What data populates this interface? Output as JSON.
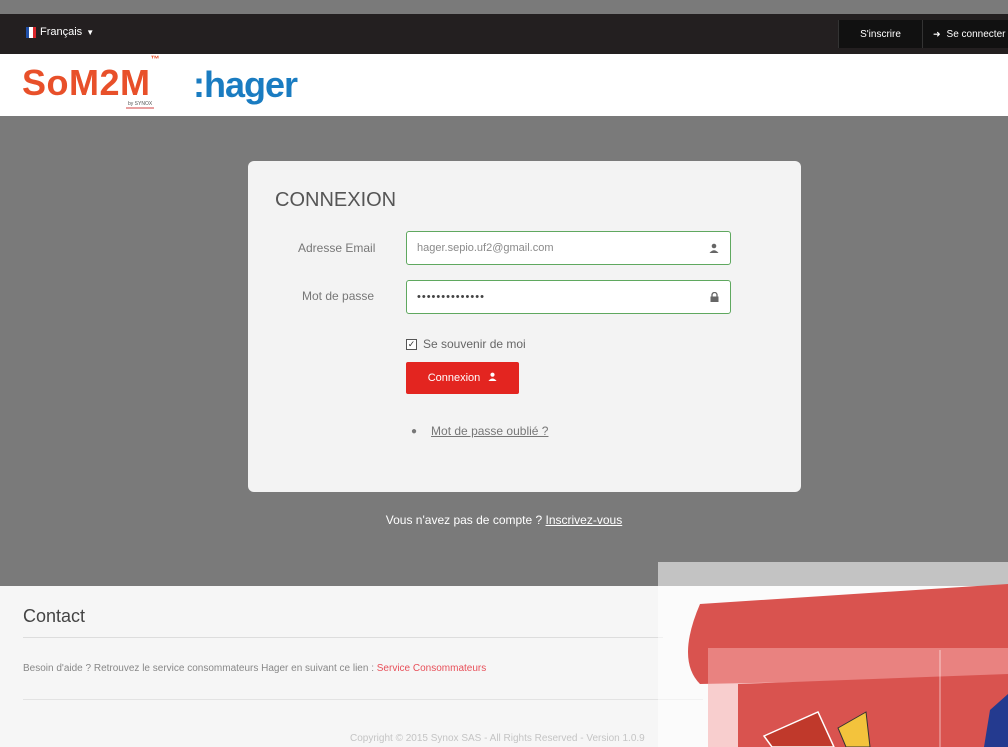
{
  "topbar": {
    "language": "Français",
    "signup_label": "S'inscrire",
    "login_label": "Se connecter"
  },
  "header": {
    "logo_som": "SoM2M",
    "logo_tm": "™",
    "logo_synox": "by SYNOX",
    "logo_hager": ":hager"
  },
  "login": {
    "title": "CONNEXION",
    "email_label": "Adresse Email",
    "email_value": "hager.sepio.uf2@gmail.com",
    "password_label": "Mot de passe",
    "password_value": "••••••••••••••",
    "remember_label": "Se souvenir de moi",
    "submit_label": "Connexion",
    "forgot_label": "Mot de passe oublié ?"
  },
  "signup_prompt": {
    "text": "Vous n'avez pas de compte ? ",
    "link": "Inscrivez-vous"
  },
  "footer": {
    "contact_title": "Contact",
    "help_text": "Besoin d'aide ? Retrouvez le service consommateurs Hager en suivant ce lien : ",
    "help_link": "Service Consommateurs",
    "copyright": "Copyright © 2015 Synox SAS - All Rights Reserved - Version 1.0.9"
  },
  "colors": {
    "accent_red": "#e32520",
    "hager_blue": "#1a7cc1",
    "som_orange": "#e8502a",
    "field_border": "#5fa85f"
  },
  "icons": {
    "user": "user-icon",
    "lock": "lock-icon",
    "login": "login-icon"
  }
}
